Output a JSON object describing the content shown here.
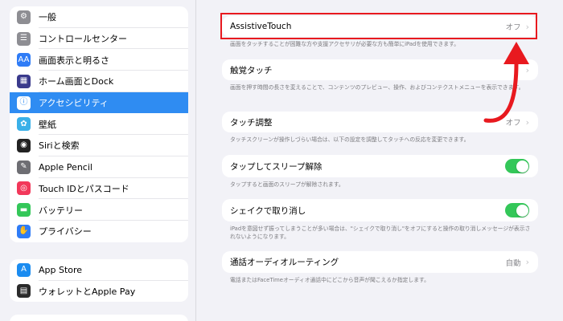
{
  "sidebar": {
    "group1": [
      {
        "label": "一般",
        "icon": "gear-icon",
        "color": "#8e8e93",
        "glyph": "⚙"
      },
      {
        "label": "コントロールセンター",
        "icon": "switches-icon",
        "color": "#8e8e93",
        "glyph": "☰"
      },
      {
        "label": "画面表示と明るさ",
        "icon": "text-size-icon",
        "color": "#2f7cf6",
        "glyph": "AA"
      },
      {
        "label": "ホーム画面とDock",
        "icon": "home-grid-icon",
        "color": "#3a3a8c",
        "glyph": "▦"
      },
      {
        "label": "アクセシビリティ",
        "icon": "accessibility-icon",
        "color": "#2f7cf6",
        "glyph": "ⓘ"
      },
      {
        "label": "壁紙",
        "icon": "wallpaper-icon",
        "color": "#3ab0e8",
        "glyph": "✿"
      },
      {
        "label": "Siriと検索",
        "icon": "siri-icon",
        "color": "#222222",
        "glyph": "◉"
      },
      {
        "label": "Apple Pencil",
        "icon": "pencil-icon",
        "color": "#6e6e73",
        "glyph": "✎"
      },
      {
        "label": "Touch IDとパスコード",
        "icon": "fingerprint-icon",
        "color": "#f2385a",
        "glyph": "◎"
      },
      {
        "label": "バッテリー",
        "icon": "battery-icon",
        "color": "#34c759",
        "glyph": "▬"
      },
      {
        "label": "プライバシー",
        "icon": "hand-icon",
        "color": "#2f7cf6",
        "glyph": "✋"
      }
    ],
    "group2": [
      {
        "label": "App Store",
        "icon": "app-store-icon",
        "color": "#1b8cf0",
        "glyph": "A"
      },
      {
        "label": "ウォレットとApple Pay",
        "icon": "wallet-icon",
        "color": "#2b2b2b",
        "glyph": "▤"
      }
    ]
  },
  "main": {
    "assistive": {
      "title": "AssistiveTouch",
      "value": "オフ",
      "desc": "画面をタッチすることが困難な方や支援アクセサリが必要な方も簡単にiPadを使用できます。"
    },
    "haptic": {
      "title": "触覚タッチ",
      "desc": "画面を押す時間の長さを変えることで、コンテンツのプレビュー、操作、およびコンテクストメニューを表示できます。"
    },
    "touch_adjust": {
      "title": "タッチ調整",
      "value": "オフ",
      "desc": "タッチスクリーンが操作しづらい場合は、以下の設定を調整してタッチへの反応を変更できます。"
    },
    "tap_wake": {
      "title": "タップしてスリープ解除",
      "state": "on",
      "desc": "タップすると画面のスリープが解除されます。"
    },
    "shake_undo": {
      "title": "シェイクで取り消し",
      "state": "on",
      "desc": "iPadを意図せず振ってしまうことが多い場合は、\"シェイクで取り消し\"をオフにすると操作の取り消しメッセージが表示されないようになります。"
    },
    "audio_routing": {
      "title": "通話オーディオルーティング",
      "value": "自動",
      "desc": "電話またはFaceTimeオーディオ通話中にどこから音声が聞こえるか指定します。"
    }
  },
  "annotation": {
    "highlight_color": "#e8191f"
  },
  "chevron": "›"
}
